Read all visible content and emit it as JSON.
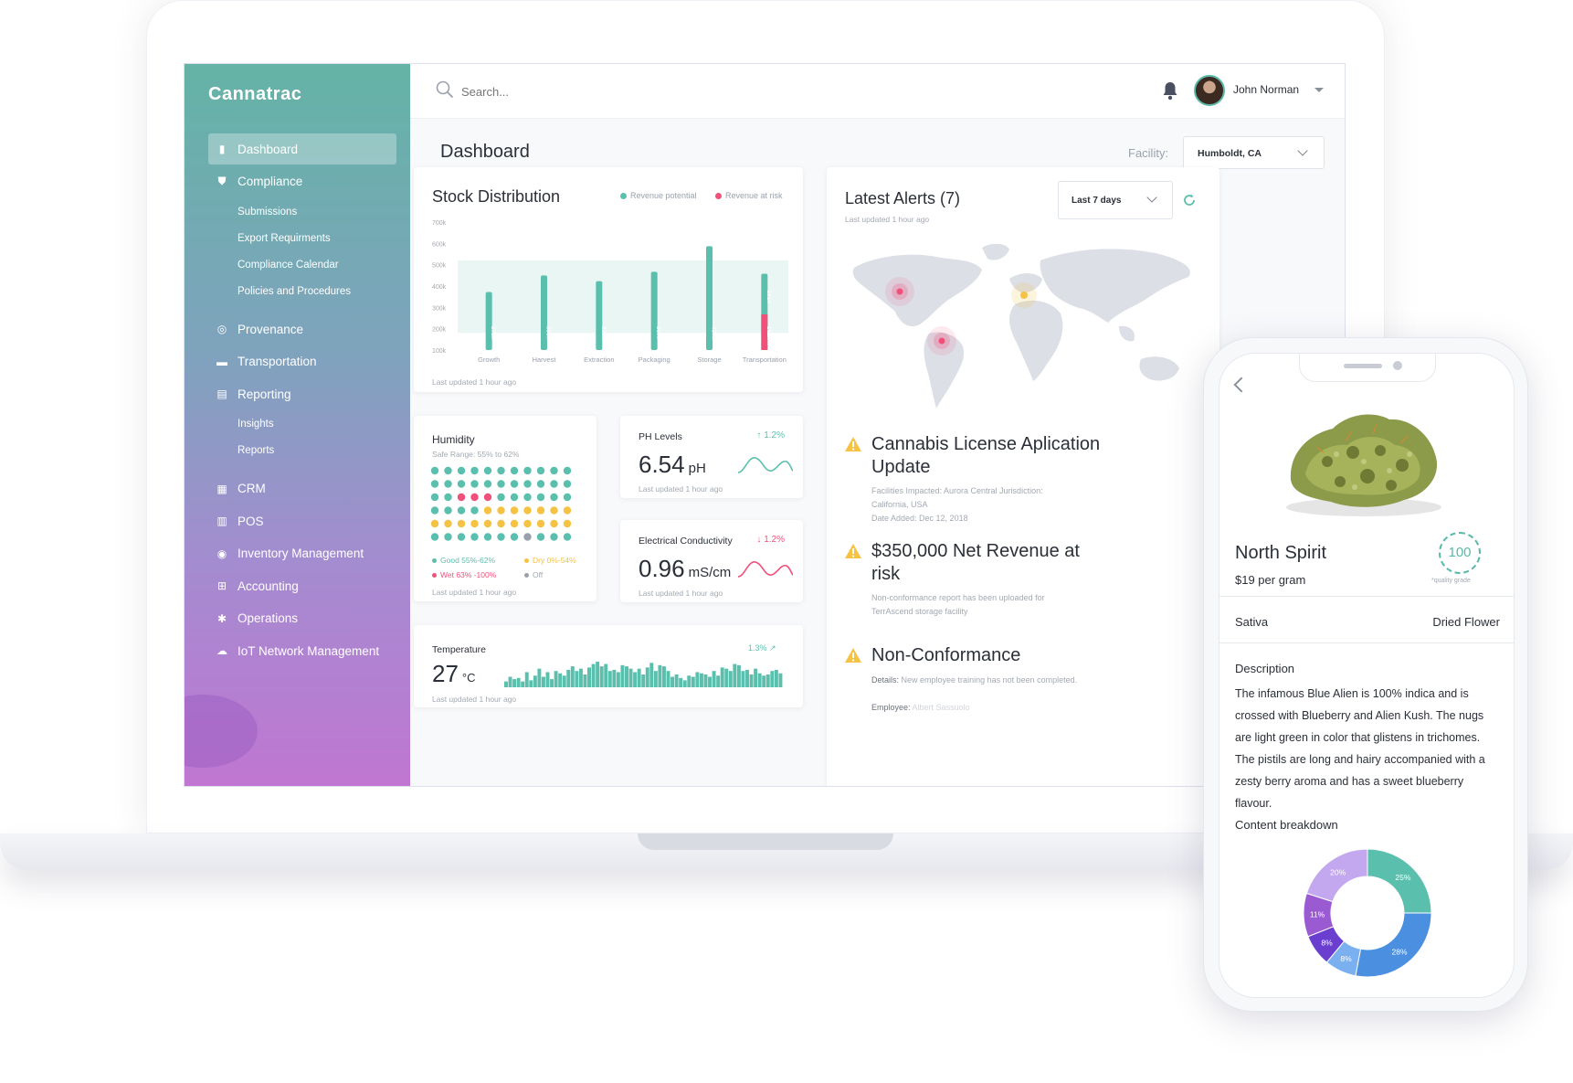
{
  "brand": "Cannatrac",
  "sidebar": {
    "items": [
      {
        "label": "Dashboard",
        "icon": "bar-chart-icon",
        "active": true
      },
      {
        "label": "Compliance",
        "icon": "shield-icon"
      },
      {
        "label": "Submissions",
        "sub": true
      },
      {
        "label": "Export Requirments",
        "sub": true
      },
      {
        "label": "Compliance Calendar",
        "sub": true
      },
      {
        "label": "Policies and Procedures",
        "sub": true
      },
      {
        "label": "Provenance",
        "icon": "globe-icon"
      },
      {
        "label": "Transportation",
        "icon": "truck-icon"
      },
      {
        "label": "Reporting",
        "icon": "document-icon"
      },
      {
        "label": "Insights",
        "sub": true
      },
      {
        "label": "Reports",
        "sub": true
      },
      {
        "label": "CRM",
        "icon": "crm-icon"
      },
      {
        "label": "POS",
        "icon": "calculator-icon"
      },
      {
        "label": "Inventory Management",
        "icon": "box-icon"
      },
      {
        "label": "Accounting",
        "icon": "grid-icon"
      },
      {
        "label": "Operations",
        "icon": "gear-icon"
      },
      {
        "label": "IoT Network Management",
        "icon": "cloud-icon"
      }
    ]
  },
  "topbar": {
    "search_placeholder": "Search...",
    "user_name": "John Norman"
  },
  "page": {
    "title": "Dashboard",
    "facility_label": "Facility:",
    "facility_value": "Humboldt, CA"
  },
  "stock": {
    "title": "Stock Distribution",
    "legend_potential": "Revenue potential",
    "legend_risk": "Revenue at risk",
    "updated": "Last updated 1 hour ago"
  },
  "chart_data": {
    "type": "bar",
    "categories": [
      "Growth",
      "Harvest",
      "Extraction",
      "Packaging",
      "Storage",
      "Transportation"
    ],
    "series": [
      {
        "name": "Revenue potential",
        "values": [
          272,
          350,
          323,
          367,
          487,
          191
        ]
      },
      {
        "name": "Revenue at risk",
        "values": [
          0,
          0,
          0,
          0,
          0,
          167
        ]
      }
    ],
    "bar_labels": [
      "272k",
      "350k",
      "323k",
      "367k",
      "487k",
      "191k"
    ],
    "risk_labels": [
      "",
      "",
      "",
      "",
      "",
      "167k"
    ],
    "yticks": [
      "700k",
      "600k",
      "500k",
      "400k",
      "300k",
      "200k",
      "100k"
    ],
    "ylim": [
      100,
      700
    ],
    "band": [
      180,
      520
    ],
    "colors": {
      "potential": "#5bbfae",
      "risk": "#f0507a",
      "band": "#eaf6f3"
    }
  },
  "humidity": {
    "title": "Humidity",
    "range": "Safe Range: 55% to 62%",
    "legend": [
      "Good 55%-62%",
      "Dry 0%-54%",
      "Wet 63% -100%",
      "Off"
    ],
    "updated": "Last updated 1 hour ago",
    "grid": [
      "GGGGGGGGGGG",
      "GGGGGGGGGGG",
      "GGRRRGGGGGG",
      "GGGGYYYYYYY",
      "YYYYYYYYYYY",
      "GGGGGGGOGGG"
    ],
    "colors": {
      "G": "#5bbfae",
      "R": "#f0507a",
      "Y": "#f5c244",
      "O": "#9aa1ad"
    }
  },
  "ph": {
    "title": "PH Levels",
    "change": "1.2%",
    "value": "6.54",
    "unit": "pH",
    "updated": "Last updated 1 hour ago"
  },
  "ec": {
    "title": "Electrical Conductivity",
    "change": "1.2%",
    "value": "0.96",
    "unit": "mS/cm",
    "updated": "Last updated 1 hour ago"
  },
  "temperature": {
    "title": "Temperature",
    "change": "1.3%",
    "value": "27",
    "unit": "°C",
    "updated": "Last updated 1 hour ago",
    "bars": [
      5,
      9,
      7,
      8,
      5,
      13,
      6,
      10,
      16,
      9,
      13,
      7,
      14,
      12,
      10,
      15,
      18,
      14,
      16,
      11,
      17,
      20,
      22,
      18,
      20,
      14,
      15,
      13,
      19,
      18,
      16,
      13,
      16,
      11,
      17,
      21,
      14,
      19,
      18,
      14,
      9,
      11,
      8,
      6,
      10,
      9,
      13,
      12,
      11,
      9,
      14,
      10,
      17,
      16,
      14,
      20,
      19,
      14,
      15,
      11,
      16,
      12,
      10,
      11,
      14,
      15,
      12
    ]
  },
  "alerts": {
    "title": "Latest Alerts (7)",
    "updated": "Last updated 1 hour ago",
    "range": "Last 7 days",
    "items": [
      {
        "title": "Cannabis License Aplication Update",
        "line1": "Facilities Impacted: Aurora Central Jurisdiction: California, USA",
        "line2": "Date Added: Dec 12, 2018"
      },
      {
        "title": "$350,000 Net Revenue at risk",
        "line1": "Non-conformance report has been uploaded for TerrAscend storage facility"
      },
      {
        "title": "Non-Conformance",
        "details_label": "Details:",
        "details": "New employee training has not been completed.",
        "employee_label": "Employee:",
        "employee": "Albert Sassuolo"
      }
    ]
  },
  "product": {
    "name": "North Spirit",
    "price": "$19 per gram",
    "grade": "100",
    "grade_label": "*quality grade",
    "strain": "Sativa",
    "form": "Dried Flower",
    "desc_title": "Description",
    "description": "The infamous Blue Alien is 100% indica and is crossed with Blueberry and Alien Kush. The nugs are light green in color that glistens in trichomes. The pistils are long and hairy accompanied with a zesty berry aroma and has a sweet blueberry flavour.",
    "breakdown_title": "Content breakdown",
    "breakdown": [
      {
        "label": "25%",
        "value": 25,
        "color": "#5bbfae"
      },
      {
        "label": "28%",
        "value": 28,
        "color": "#4a8fe0"
      },
      {
        "label": "8%",
        "value": 8,
        "color": "#7ab0f0"
      },
      {
        "label": "8%",
        "value": 8,
        "color": "#6a3fd0"
      },
      {
        "label": "11%",
        "value": 11,
        "color": "#9a5ad2"
      },
      {
        "label": "20%",
        "value": 20,
        "color": "#c3a8f0"
      }
    ]
  }
}
